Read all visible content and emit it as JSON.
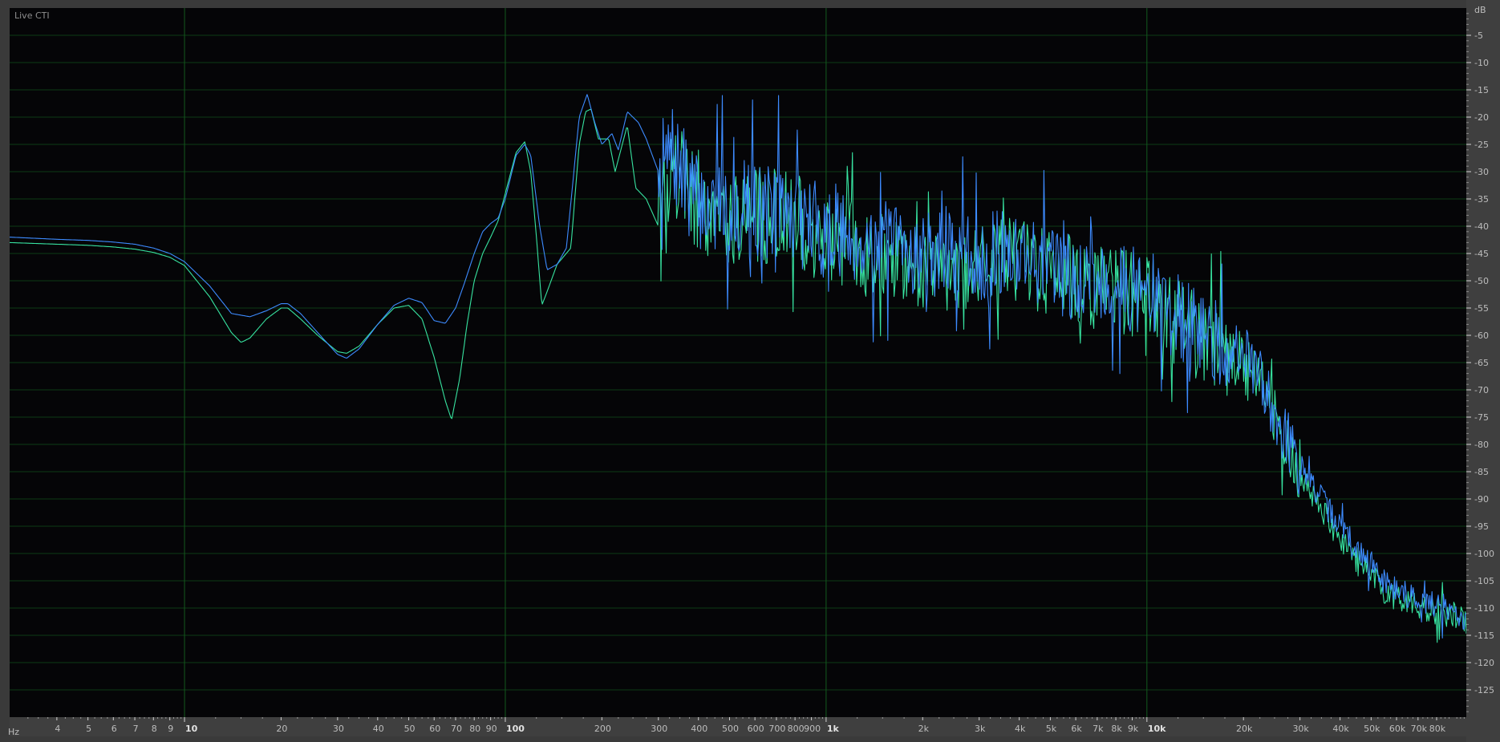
{
  "panel": {
    "title": "Live CTI"
  },
  "chart_data": {
    "type": "line",
    "title": "",
    "xlabel": "Hz",
    "ylabel": "dB",
    "x_scale": "log",
    "xlim": [
      2.85,
      99000
    ],
    "ylim": [
      -130,
      0
    ],
    "grid": true,
    "x_ticks": [
      {
        "value": 4,
        "label": "4",
        "major": false
      },
      {
        "value": 5,
        "label": "5",
        "major": false
      },
      {
        "value": 6,
        "label": "6",
        "major": false
      },
      {
        "value": 7,
        "label": "7",
        "major": false
      },
      {
        "value": 8,
        "label": "8",
        "major": false
      },
      {
        "value": 9,
        "label": "9",
        "major": false
      },
      {
        "value": 10,
        "label": "10",
        "major": true
      },
      {
        "value": 20,
        "label": "20",
        "major": false
      },
      {
        "value": 30,
        "label": "30",
        "major": false
      },
      {
        "value": 40,
        "label": "40",
        "major": false
      },
      {
        "value": 50,
        "label": "50",
        "major": false
      },
      {
        "value": 60,
        "label": "60",
        "major": false
      },
      {
        "value": 70,
        "label": "70",
        "major": false
      },
      {
        "value": 80,
        "label": "80",
        "major": false
      },
      {
        "value": 90,
        "label": "90",
        "major": false
      },
      {
        "value": 100,
        "label": "100",
        "major": true
      },
      {
        "value": 200,
        "label": "200",
        "major": false
      },
      {
        "value": 300,
        "label": "300",
        "major": false
      },
      {
        "value": 400,
        "label": "400",
        "major": false
      },
      {
        "value": 500,
        "label": "500",
        "major": false
      },
      {
        "value": 600,
        "label": "600",
        "major": false
      },
      {
        "value": 700,
        "label": "700",
        "major": false
      },
      {
        "value": 800,
        "label": "800",
        "major": false
      },
      {
        "value": 900,
        "label": "900",
        "major": false
      },
      {
        "value": 1000,
        "label": "1k",
        "major": true
      },
      {
        "value": 2000,
        "label": "2k",
        "major": false
      },
      {
        "value": 3000,
        "label": "3k",
        "major": false
      },
      {
        "value": 4000,
        "label": "4k",
        "major": false
      },
      {
        "value": 5000,
        "label": "5k",
        "major": false
      },
      {
        "value": 6000,
        "label": "6k",
        "major": false
      },
      {
        "value": 7000,
        "label": "7k",
        "major": false
      },
      {
        "value": 8000,
        "label": "8k",
        "major": false
      },
      {
        "value": 9000,
        "label": "9k",
        "major": false
      },
      {
        "value": 10000,
        "label": "10k",
        "major": true
      },
      {
        "value": 20000,
        "label": "20k",
        "major": false
      },
      {
        "value": 30000,
        "label": "30k",
        "major": false
      },
      {
        "value": 40000,
        "label": "40k",
        "major": false
      },
      {
        "value": 50000,
        "label": "50k",
        "major": false
      },
      {
        "value": 60000,
        "label": "60k",
        "major": false
      },
      {
        "value": 70000,
        "label": "70k",
        "major": false
      },
      {
        "value": 80000,
        "label": "80k",
        "major": false
      }
    ],
    "y_ticks": [
      -5,
      -10,
      -15,
      -20,
      -25,
      -30,
      -35,
      -40,
      -45,
      -50,
      -55,
      -60,
      -65,
      -70,
      -75,
      -80,
      -85,
      -90,
      -95,
      -100,
      -105,
      -110,
      -115,
      -120,
      -125
    ],
    "series": [
      {
        "color": "#3d8bff",
        "noise_seed": 7,
        "points": [
          [
            2.85,
            -42
          ],
          [
            4,
            -42.4
          ],
          [
            5,
            -42.6
          ],
          [
            6,
            -42.9
          ],
          [
            7,
            -43.3
          ],
          [
            8,
            -44
          ],
          [
            9,
            -45
          ],
          [
            10,
            -46.5
          ],
          [
            12,
            -51
          ],
          [
            14,
            -56
          ],
          [
            16,
            -56.6
          ],
          [
            18,
            -55.5
          ],
          [
            20,
            -54.2
          ],
          [
            21,
            -54.2
          ],
          [
            23,
            -56
          ],
          [
            26,
            -59.5
          ],
          [
            30,
            -63.5
          ],
          [
            32,
            -64.2
          ],
          [
            35,
            -62.5
          ],
          [
            40,
            -58
          ],
          [
            45,
            -54.5
          ],
          [
            50,
            -53.2
          ],
          [
            55,
            -54
          ],
          [
            60,
            -57.3
          ],
          [
            65,
            -57.8
          ],
          [
            70,
            -55
          ],
          [
            75,
            -50
          ],
          [
            80,
            -45
          ],
          [
            85,
            -41
          ],
          [
            90,
            -39.5
          ],
          [
            95,
            -38.5
          ],
          [
            100,
            -35
          ],
          [
            108,
            -27
          ],
          [
            115,
            -25
          ],
          [
            120,
            -27
          ],
          [
            128,
            -40
          ],
          [
            135,
            -48
          ],
          [
            145,
            -47
          ],
          [
            155,
            -44
          ],
          [
            170,
            -20
          ],
          [
            180,
            -15.8
          ],
          [
            190,
            -21
          ],
          [
            200,
            -25
          ],
          [
            215,
            -23
          ],
          [
            225,
            -26
          ],
          [
            240,
            -19
          ],
          [
            260,
            -21
          ],
          [
            275,
            -24
          ],
          [
            300,
            -30
          ],
          [
            330,
            -27
          ],
          [
            360,
            -31
          ],
          [
            400,
            -36
          ],
          [
            500,
            -37
          ],
          [
            700,
            -37
          ],
          [
            1000,
            -41
          ],
          [
            2000,
            -45
          ],
          [
            3000,
            -46
          ],
          [
            4000,
            -44
          ],
          [
            5000,
            -48
          ],
          [
            6000,
            -49
          ],
          [
            7000,
            -50
          ],
          [
            8000,
            -51
          ],
          [
            10000,
            -52
          ],
          [
            12000,
            -56
          ],
          [
            15000,
            -60
          ],
          [
            18000,
            -63
          ],
          [
            20000,
            -64
          ],
          [
            22000,
            -67
          ],
          [
            24000,
            -71
          ],
          [
            26000,
            -76
          ],
          [
            30000,
            -84
          ],
          [
            35000,
            -90
          ],
          [
            40000,
            -95
          ],
          [
            45000,
            -99
          ],
          [
            50000,
            -102
          ],
          [
            55000,
            -105
          ],
          [
            60000,
            -106.5
          ],
          [
            70000,
            -108.5
          ],
          [
            80000,
            -109.5
          ],
          [
            90000,
            -110.5
          ],
          [
            99000,
            -112
          ]
        ]
      },
      {
        "color": "#37e3a0",
        "noise_seed": 19,
        "points": [
          [
            2.85,
            -43
          ],
          [
            4,
            -43.3
          ],
          [
            5,
            -43.5
          ],
          [
            6,
            -43.8
          ],
          [
            7,
            -44.2
          ],
          [
            8,
            -44.8
          ],
          [
            9,
            -45.7
          ],
          [
            10,
            -47.2
          ],
          [
            12,
            -53
          ],
          [
            14,
            -59.5
          ],
          [
            15,
            -61.3
          ],
          [
            16,
            -60.5
          ],
          [
            18,
            -57
          ],
          [
            20,
            -55
          ],
          [
            21,
            -55
          ],
          [
            23,
            -57
          ],
          [
            26,
            -60
          ],
          [
            30,
            -63
          ],
          [
            32,
            -63.3
          ],
          [
            35,
            -62
          ],
          [
            40,
            -58
          ],
          [
            45,
            -55
          ],
          [
            50,
            -54.5
          ],
          [
            55,
            -57
          ],
          [
            60,
            -64
          ],
          [
            65,
            -72
          ],
          [
            68,
            -75.5
          ],
          [
            72,
            -68
          ],
          [
            76,
            -58
          ],
          [
            80,
            -50
          ],
          [
            85,
            -45
          ],
          [
            90,
            -42
          ],
          [
            95,
            -39
          ],
          [
            100,
            -34
          ],
          [
            108,
            -26.5
          ],
          [
            115,
            -24.5
          ],
          [
            120,
            -30
          ],
          [
            125,
            -42
          ],
          [
            130,
            -54.5
          ],
          [
            135,
            -52
          ],
          [
            145,
            -47
          ],
          [
            160,
            -44
          ],
          [
            170,
            -25
          ],
          [
            178,
            -19
          ],
          [
            185,
            -18.5
          ],
          [
            195,
            -24
          ],
          [
            210,
            -24
          ],
          [
            220,
            -30
          ],
          [
            240,
            -21.5
          ],
          [
            255,
            -33
          ],
          [
            275,
            -35
          ],
          [
            300,
            -40
          ],
          [
            330,
            -30
          ],
          [
            360,
            -31
          ],
          [
            400,
            -36
          ],
          [
            500,
            -38
          ],
          [
            700,
            -38
          ],
          [
            1000,
            -42
          ],
          [
            2000,
            -47
          ],
          [
            3000,
            -48
          ],
          [
            4000,
            -46
          ],
          [
            5000,
            -49
          ],
          [
            6000,
            -50
          ],
          [
            7000,
            -51
          ],
          [
            8000,
            -52
          ],
          [
            10000,
            -53
          ],
          [
            12000,
            -57
          ],
          [
            15000,
            -61
          ],
          [
            18000,
            -64
          ],
          [
            20000,
            -65
          ],
          [
            22000,
            -68
          ],
          [
            24000,
            -72
          ],
          [
            26000,
            -78
          ],
          [
            30000,
            -86
          ],
          [
            35000,
            -92
          ],
          [
            40000,
            -97
          ],
          [
            45000,
            -101
          ],
          [
            50000,
            -104
          ],
          [
            55000,
            -107
          ],
          [
            60000,
            -108.5
          ],
          [
            70000,
            -110
          ],
          [
            80000,
            -110.5
          ],
          [
            90000,
            -111
          ],
          [
            99000,
            -112.5
          ]
        ]
      }
    ]
  }
}
